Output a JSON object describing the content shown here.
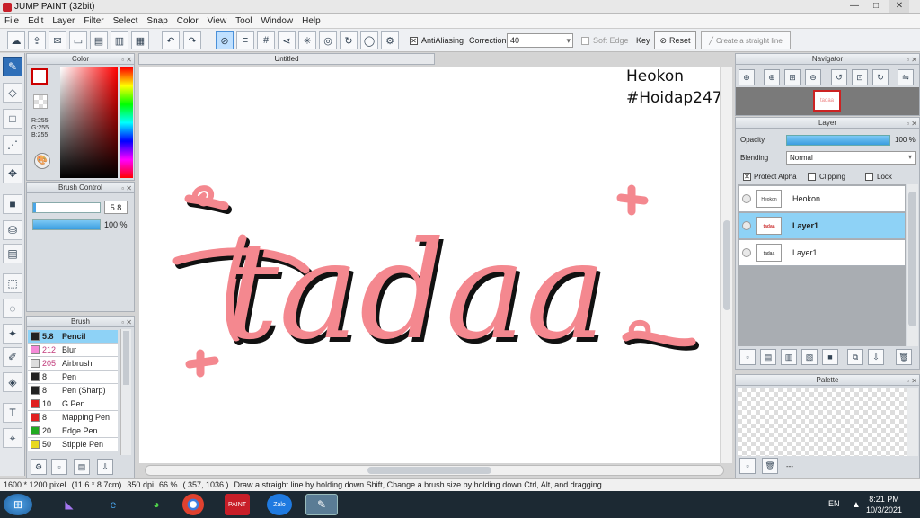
{
  "window": {
    "title": "JUMP PAINT (32bit)",
    "min": "—",
    "max": "□",
    "close": "✕"
  },
  "menu": [
    "File",
    "Edit",
    "Layer",
    "Filter",
    "Select",
    "Snap",
    "Color",
    "View",
    "Tool",
    "Window",
    "Help"
  ],
  "toolbar": {
    "antialiasing_label": "AntiAliasing",
    "correction_label": "Correction",
    "correction_value": "40",
    "soft_edge_label": "Soft Edge",
    "key_label": "Key",
    "reset_label": "Reset",
    "straight_line_label": "Create a straight line"
  },
  "color_panel": {
    "title": "Color",
    "r": "R:255",
    "g": "G:255",
    "b": "B:255",
    "current_color": "#ffffff"
  },
  "brush_control": {
    "title": "Brush Control",
    "size": "5.8",
    "opacity": "100 %"
  },
  "brush_panel": {
    "title": "Brush",
    "items": [
      {
        "size": "5.8",
        "name": "Pencil",
        "color": "#222222"
      },
      {
        "size": "212",
        "name": "Blur",
        "color": "#f58ad8"
      },
      {
        "size": "205",
        "name": "Airbrush",
        "color": "#dddddd"
      },
      {
        "size": "8",
        "name": "Pen",
        "color": "#222222"
      },
      {
        "size": "8",
        "name": "Pen (Sharp)",
        "color": "#222222"
      },
      {
        "size": "10",
        "name": "G Pen",
        "color": "#e02020"
      },
      {
        "size": "8",
        "name": "Mapping Pen",
        "color": "#e02020"
      },
      {
        "size": "20",
        "name": "Edge Pen",
        "color": "#22aa22"
      },
      {
        "size": "50",
        "name": "Stipple Pen",
        "color": "#e8d820"
      }
    ]
  },
  "canvas": {
    "tab_title": "Untitled",
    "watermark_line1": "Heokon",
    "watermark_line2": "#Hoidap247",
    "lettering": "tadaa",
    "ink_color": "#f4888f",
    "shadow_color": "#111111"
  },
  "navigator": {
    "title": "Navigator"
  },
  "layer_panel": {
    "title": "Layer",
    "opacity_label": "Opacity",
    "opacity_value": "100 %",
    "blending_label": "Blending",
    "blending_value": "Normal",
    "protect_alpha": "Protect Alpha",
    "clipping": "Clipping",
    "lock": "Lock",
    "layers": [
      {
        "name": "Heokon",
        "thumb": "Heokon #Hoidap247"
      },
      {
        "name": "Layer1",
        "thumb": "tadaa"
      },
      {
        "name": "Layer1",
        "thumb": "tadaa"
      }
    ]
  },
  "palette": {
    "title": "Palette",
    "extra": "---"
  },
  "status": {
    "size": "1600 * 1200 pixel",
    "cm": "(11.6 * 8.7cm)",
    "dpi": "350 dpi",
    "zoom": "66 %",
    "coords": "( 357, 1036 )",
    "hint": "Draw a straight line by holding down Shift, Change a brush size by holding down Ctrl, Alt, and dragging"
  },
  "taskbar": {
    "lang": "EN",
    "time": "8:21 PM",
    "date": "10/3/2021"
  }
}
